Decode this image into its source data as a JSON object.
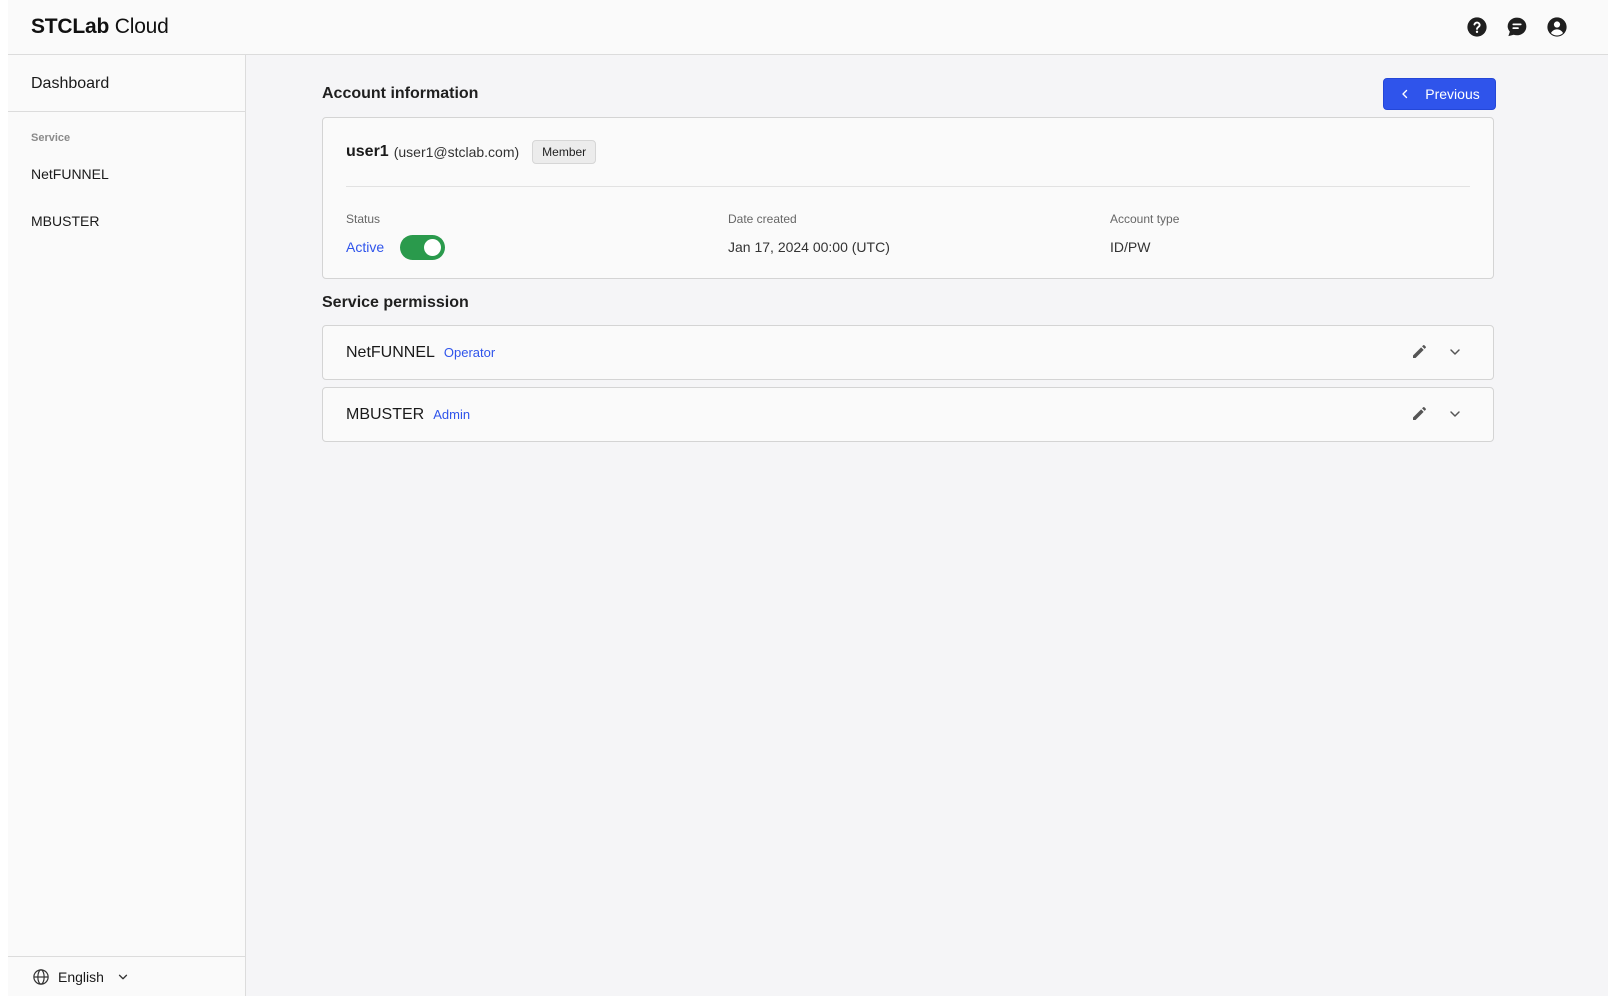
{
  "header": {
    "logo_bold": "STCLab",
    "logo_light": " Cloud",
    "icons": [
      "help-icon",
      "chat-icon",
      "account-icon"
    ]
  },
  "sidebar": {
    "dashboard": "Dashboard",
    "section_label": "Service",
    "items": [
      {
        "label": "NetFUNNEL"
      },
      {
        "label": "MBUSTER"
      }
    ],
    "language": "English"
  },
  "account": {
    "title": "Account information",
    "previous_label": "Previous",
    "username": "user1",
    "email": "(user1@stclab.com)",
    "role_badge": "Member",
    "status_label": "Status",
    "status_value": "Active",
    "status_enabled": true,
    "date_label": "Date created",
    "date_value": "Jan 17, 2024 00:00 (UTC)",
    "type_label": "Account type",
    "type_value": "ID/PW"
  },
  "permissions": {
    "title": "Service permission",
    "items": [
      {
        "service": "NetFUNNEL",
        "role": "Operator"
      },
      {
        "service": "MBUSTER",
        "role": "Admin"
      }
    ]
  },
  "colors": {
    "accent": "#2f54eb",
    "toggle_on": "#2a9a4c"
  }
}
